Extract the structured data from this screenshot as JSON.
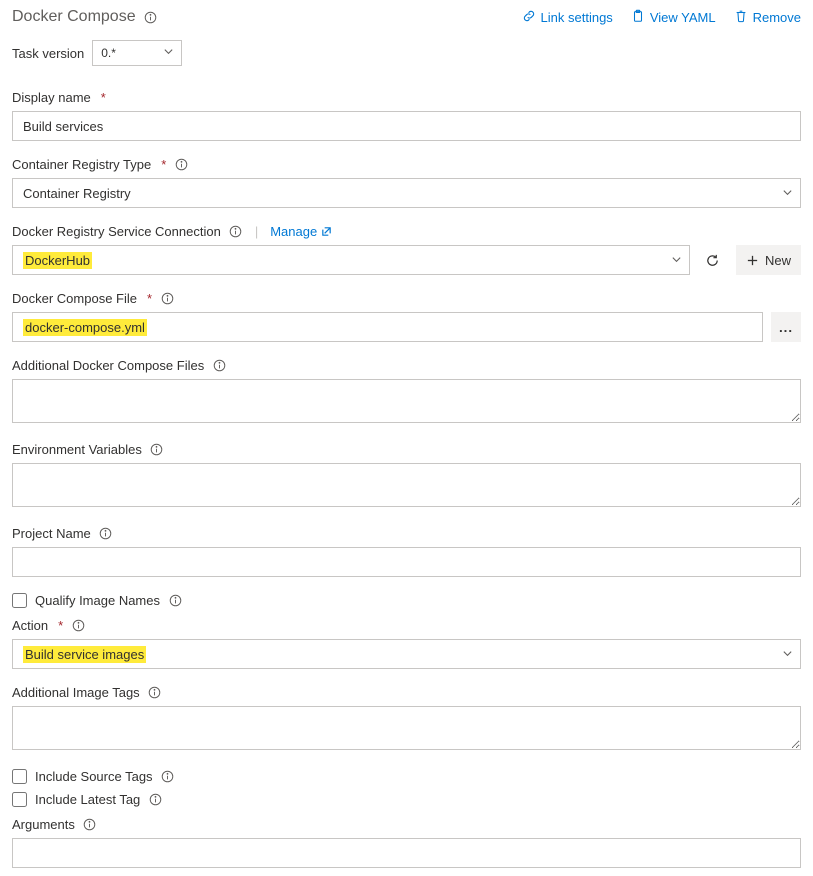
{
  "header": {
    "title": "Docker Compose",
    "actions": {
      "link_settings": "Link settings",
      "view_yaml": "View YAML",
      "remove": "Remove"
    }
  },
  "task_version": {
    "label": "Task version",
    "value": "0.*"
  },
  "fields": {
    "display_name": {
      "label": "Display name",
      "value": "Build services"
    },
    "container_registry_type": {
      "label": "Container Registry Type",
      "value": "Container Registry"
    },
    "docker_registry_conn": {
      "label": "Docker Registry Service Connection",
      "value": "DockerHub",
      "manage": "Manage",
      "new": "New"
    },
    "docker_compose_file": {
      "label": "Docker Compose File",
      "value": "docker-compose.yml"
    },
    "additional_compose": {
      "label": "Additional Docker Compose Files",
      "value": ""
    },
    "env_vars": {
      "label": "Environment Variables",
      "value": ""
    },
    "project_name": {
      "label": "Project Name",
      "value": ""
    },
    "qualify_image_names": {
      "label": "Qualify Image Names",
      "checked": false
    },
    "action": {
      "label": "Action",
      "value": "Build service images"
    },
    "additional_image_tags": {
      "label": "Additional Image Tags",
      "value": ""
    },
    "include_source_tags": {
      "label": "Include Source Tags",
      "checked": false
    },
    "include_latest_tag": {
      "label": "Include Latest Tag",
      "checked": false
    },
    "arguments": {
      "label": "Arguments",
      "value": ""
    }
  }
}
